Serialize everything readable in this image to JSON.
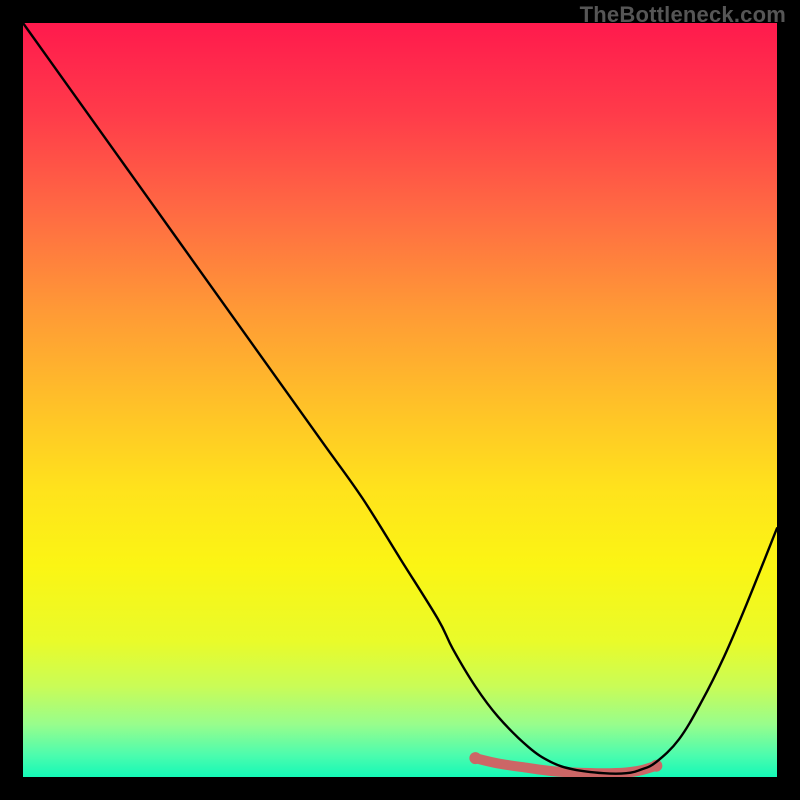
{
  "watermark": "TheBottleneck.com",
  "chart_data": {
    "type": "line",
    "title": "",
    "xlabel": "",
    "ylabel": "",
    "xlim": [
      0,
      100
    ],
    "ylim": [
      0,
      100
    ],
    "x": [
      0,
      5,
      10,
      15,
      20,
      25,
      30,
      35,
      40,
      45,
      50,
      55,
      57,
      60,
      63,
      67,
      70,
      73,
      77,
      80,
      82,
      84,
      87,
      90,
      93,
      96,
      100
    ],
    "values": [
      100,
      93,
      86,
      79,
      72,
      65,
      58,
      51,
      44,
      37,
      29,
      21,
      17,
      12,
      8,
      4,
      2,
      1,
      0.5,
      0.5,
      1,
      2,
      5,
      10,
      16,
      23,
      33
    ],
    "highlight_segment": {
      "x": [
        60,
        63,
        67,
        70,
        73,
        77,
        80,
        82,
        84
      ],
      "values": [
        2.5,
        1.8,
        1.2,
        0.8,
        0.6,
        0.5,
        0.6,
        0.9,
        1.5
      ],
      "color": "#cc6666"
    },
    "gradient_stops": [
      {
        "offset": 0.0,
        "color": "#ff1a4d"
      },
      {
        "offset": 0.12,
        "color": "#ff3b4a"
      },
      {
        "offset": 0.25,
        "color": "#ff6a43"
      },
      {
        "offset": 0.38,
        "color": "#ff9936"
      },
      {
        "offset": 0.5,
        "color": "#ffbf29"
      },
      {
        "offset": 0.62,
        "color": "#ffe31c"
      },
      {
        "offset": 0.72,
        "color": "#fbf514"
      },
      {
        "offset": 0.82,
        "color": "#e9fb2a"
      },
      {
        "offset": 0.88,
        "color": "#c9fc57"
      },
      {
        "offset": 0.93,
        "color": "#98fd8c"
      },
      {
        "offset": 0.97,
        "color": "#4efcad"
      },
      {
        "offset": 1.0,
        "color": "#14f9b7"
      }
    ]
  }
}
